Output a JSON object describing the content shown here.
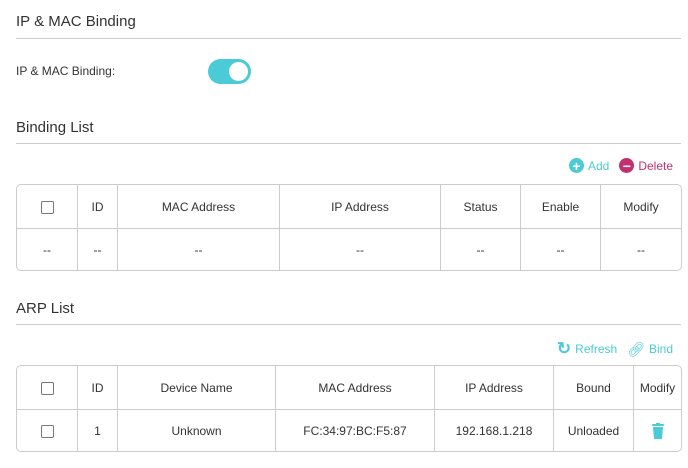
{
  "section1": {
    "title": "IP & MAC Binding",
    "toggle_label": "IP & MAC Binding:",
    "toggle_on": true
  },
  "binding": {
    "title": "Binding List",
    "add": "Add",
    "delete": "Delete",
    "headers": [
      "ID",
      "MAC Address",
      "IP Address",
      "Status",
      "Enable",
      "Modify"
    ],
    "row": [
      "--",
      "--",
      "--",
      "--",
      "--",
      "--",
      "--"
    ]
  },
  "arp": {
    "title": "ARP List",
    "refresh": "Refresh",
    "bind": "Bind",
    "headers": [
      "ID",
      "Device Name",
      "MAC Address",
      "IP Address",
      "Bound",
      "Modify"
    ],
    "row": {
      "id": "1",
      "name": "Unknown",
      "mac": "FC:34:97:BC:F5:87",
      "ip": "192.168.1.218",
      "bound": "Unloaded"
    }
  },
  "colors": {
    "accent": "#4acbd6",
    "delete": "#c2306f"
  }
}
